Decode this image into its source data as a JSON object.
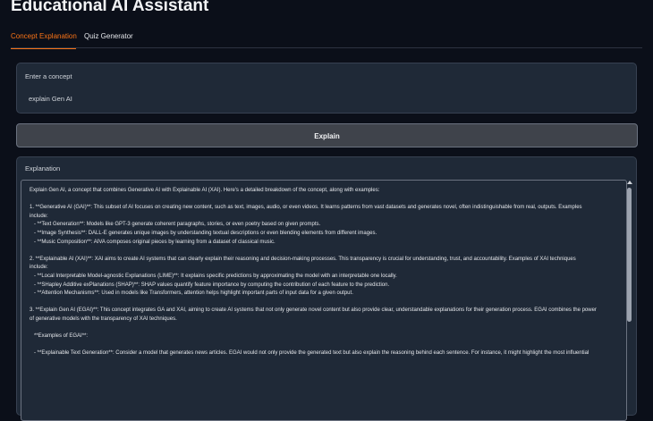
{
  "app": {
    "title": "Educational AI Assistant"
  },
  "tabs": [
    {
      "label": "Concept Explanation"
    },
    {
      "label": "Quiz Generator"
    }
  ],
  "concept": {
    "label": "Enter a concept",
    "value": "explain Gen AI"
  },
  "explain_button": {
    "label": "Explain"
  },
  "explanation": {
    "label": "Explanation",
    "lines": [
      "Explain Gen AI, a concept that combines Generative AI with Explainable AI (XAI). Here's a detailed breakdown of the concept, along with examples:",
      "",
      "1. **Generative AI (GAI)**: This subset of AI focuses on creating new content, such as text, images, audio, or even videos. It learns patterns from vast datasets and generates novel, often indistinguishable from real, outputs. Examples",
      "include:",
      "   - **Text Generation**: Models like GPT-3 generate coherent paragraphs, stories, or even poetry based on given prompts.",
      "   - **Image Synthesis**: DALL-E generates unique images by understanding textual descriptions or even blending elements from different images.",
      "   - **Music Composition**: AIVA composes original pieces by learning from a dataset of classical music.",
      "",
      "2. **Explainable AI (XAI)**: XAI aims to create AI systems that can clearly explain their reasoning and decision-making processes. This transparency is crucial for understanding, trust, and accountability. Examples of XAI techniques",
      "include:",
      "   - **Local Interpretable Model-agnostic Explanations (LIME)**: It explains specific predictions by approximating the model with an interpretable one locally.",
      "   - **SHapley Additive exPlanations (SHAP)**: SHAP values quantify feature importance by computing the contribution of each feature to the prediction.",
      "   - **Attention Mechanisms**: Used in models like Transformers, attention helps highlight important parts of input data for a given output.",
      "",
      "3. **Explain Gen AI (EGAI)**: This concept integrates GA and XAI, aiming to create AI systems that not only generate novel content but also provide clear, understandable explanations for their generation process. EGAI combines the power",
      "of generative models with the transparency of XAI techniques.",
      "",
      "   **Examples of EGAI**:",
      "",
      "   - **Explainable Text Generation**: Consider a model that generates news articles. EGAI would not only provide the generated text but also explain the reasoning behind each sentence. For instance, it might highlight the most influential"
    ]
  }
}
